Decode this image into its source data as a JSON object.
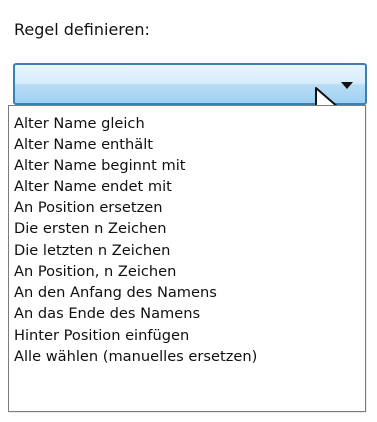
{
  "rule_section": {
    "label": "Regel definieren:",
    "selected_value": "",
    "options": [
      "Alter Name gleich",
      "Alter Name enthält",
      "Alter Name beginnt mit",
      "Alter Name endet mit",
      "An Position ersetzen",
      "Die ersten n Zeichen",
      "Die letzten n Zeichen",
      "An Position, n Zeichen",
      "An den Anfang des Namens",
      "An das Ende des Namens",
      "Hinter Position einfügen",
      "Alle wählen (manuelles ersetzen)"
    ]
  },
  "icons": {
    "dropdown_arrow": "chevron-down-icon",
    "cursor": "mouse-pointer-icon"
  },
  "colors": {
    "combo_border": "#3c7fb1",
    "combo_fill": "#b9dcf5",
    "dropdown_border": "#7b7b7b"
  }
}
